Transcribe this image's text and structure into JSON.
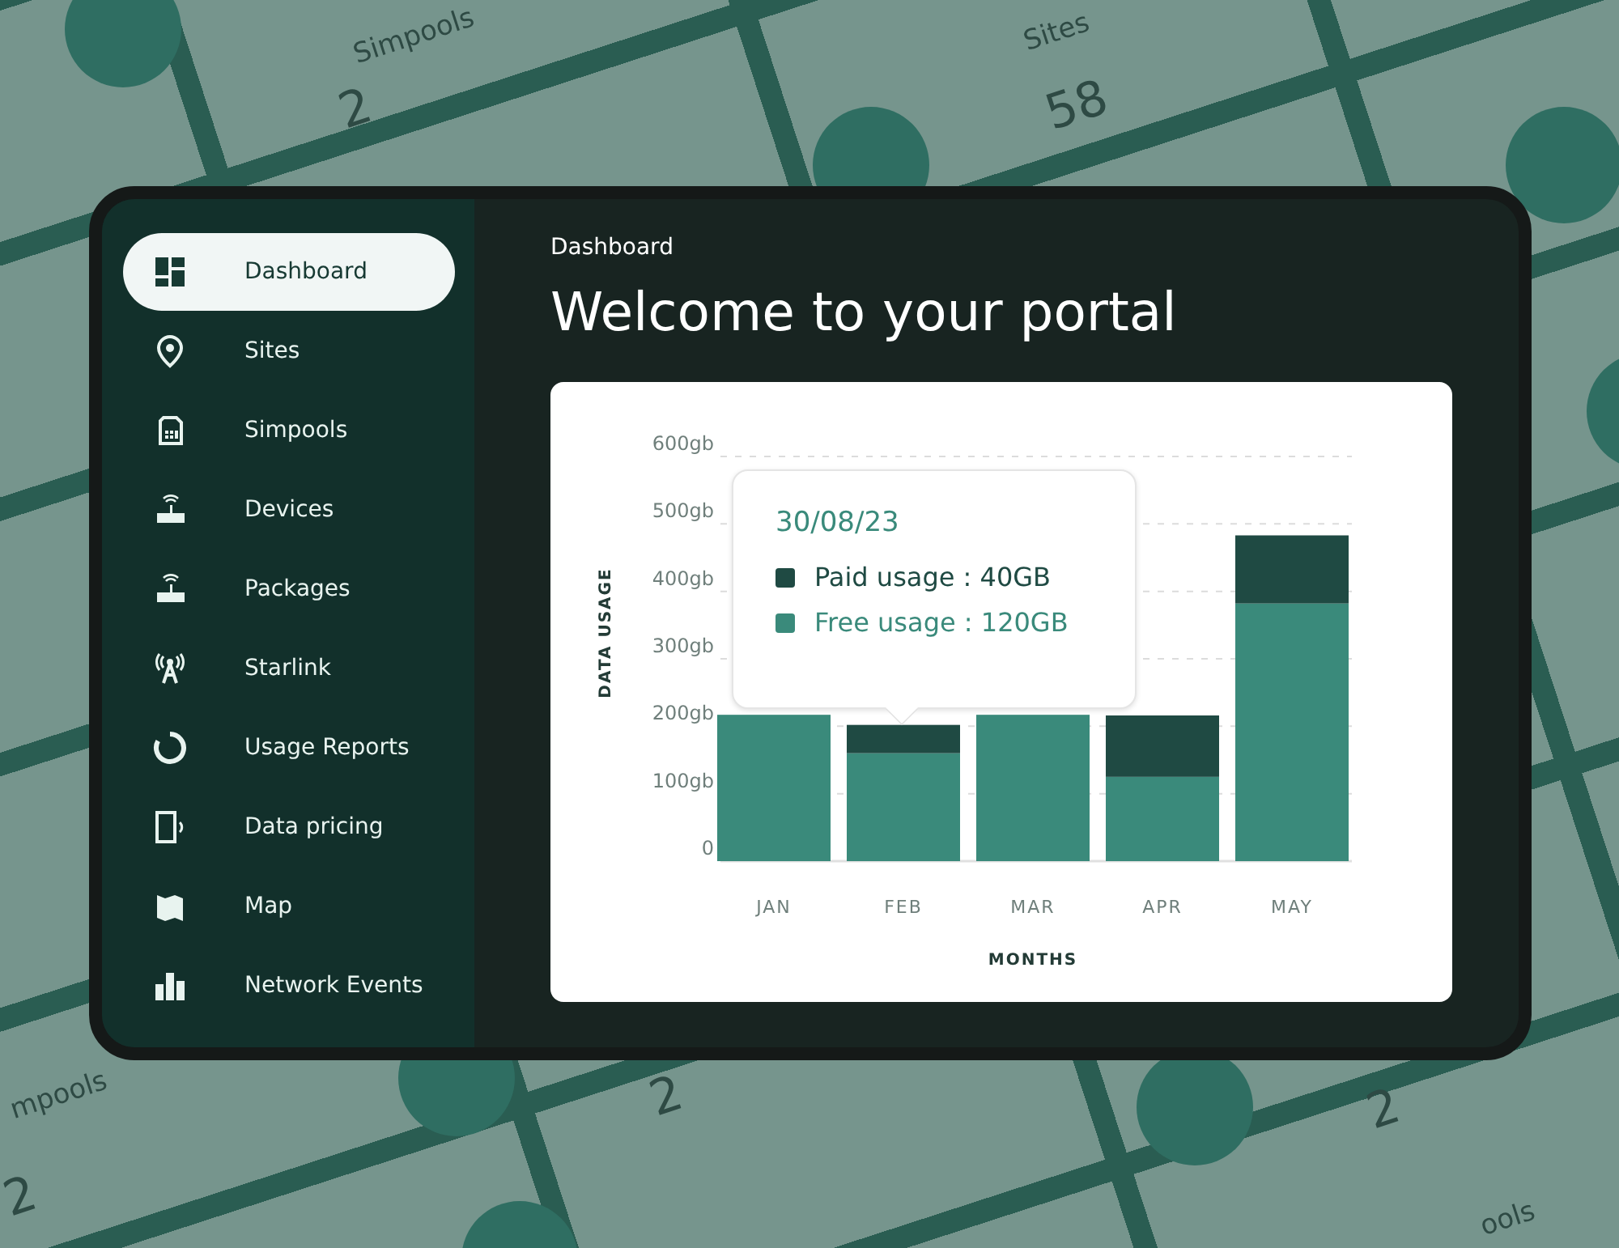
{
  "background_tiles": [
    {
      "label": "Simpools",
      "value": "2"
    },
    {
      "label": "Sites",
      "value": "58"
    },
    {
      "label": "mpools",
      "value": "2"
    },
    {
      "value": "2"
    },
    {
      "value": "2"
    },
    {
      "label": "ools"
    }
  ],
  "sidebar": {
    "items": [
      {
        "label": "Dashboard",
        "selected": true
      },
      {
        "label": "Sites",
        "selected": false
      },
      {
        "label": "Simpools",
        "selected": false
      },
      {
        "label": "Devices",
        "selected": false
      },
      {
        "label": "Packages",
        "selected": false
      },
      {
        "label": "Starlink",
        "selected": false
      },
      {
        "label": "Usage Reports",
        "selected": false
      },
      {
        "label": "Data pricing",
        "selected": false
      },
      {
        "label": "Map",
        "selected": false
      },
      {
        "label": "Network Events",
        "selected": false
      }
    ]
  },
  "main": {
    "breadcrumb": "Dashboard",
    "title": "Welcome to your portal",
    "chart_data": {
      "type": "bar",
      "stacked": true,
      "grid": true,
      "xlabel": "MONTHS",
      "ylabel": "DATA USAGE",
      "categories": [
        "JAN",
        "FEB",
        "MAR",
        "APR",
        "MAY"
      ],
      "series": [
        {
          "name": "Paid usage",
          "color": "#1f4a43",
          "values": [
            0,
            42,
            0,
            91,
            101
          ]
        },
        {
          "name": "Free usage",
          "color": "#3a8a7b",
          "values": [
            217,
            160,
            217,
            125,
            382
          ]
        }
      ],
      "ylim": [
        0,
        600
      ],
      "yticks": [
        {
          "value": 0,
          "label": "0"
        },
        {
          "value": 100,
          "label": "100gb"
        },
        {
          "value": 200,
          "label": "200gb"
        },
        {
          "value": 300,
          "label": "300gb"
        },
        {
          "value": 400,
          "label": "400gb"
        },
        {
          "value": 500,
          "label": "500gb"
        },
        {
          "value": 600,
          "label": "600gb"
        }
      ]
    },
    "tooltip": {
      "date": "30/08/23",
      "lines": [
        {
          "value": ": 40GB"
        },
        {
          "value": ": 120GB"
        }
      ]
    }
  }
}
